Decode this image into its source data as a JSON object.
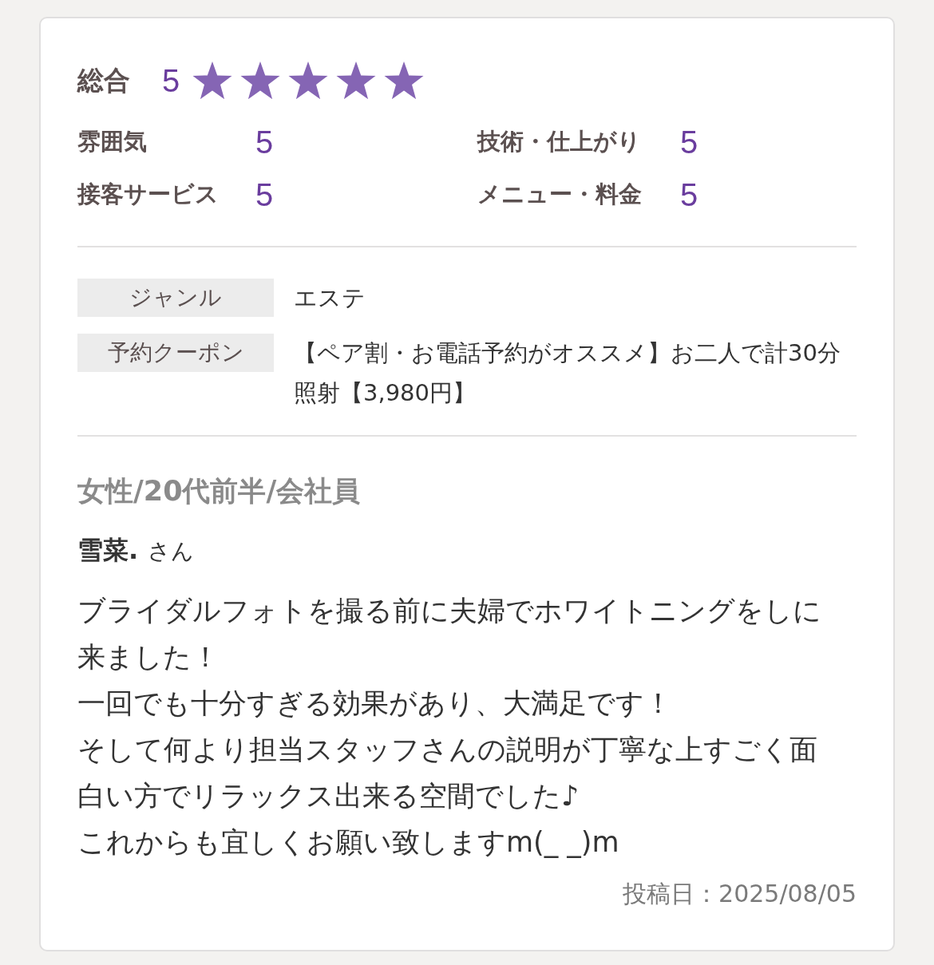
{
  "overall": {
    "label": "総合",
    "score": "5",
    "stars": 5
  },
  "ratings": [
    {
      "label": "雰囲気",
      "score": "5"
    },
    {
      "label": "技術・仕上がり",
      "score": "5"
    },
    {
      "label": "接客サービス",
      "score": "5"
    },
    {
      "label": "メニュー・料金",
      "score": "5"
    }
  ],
  "details": [
    {
      "label": "ジャンル",
      "value": "エステ"
    },
    {
      "label": "予約クーポン",
      "value": "【ペア割・お電話予約がオススメ】お二人で計30分照射【3,980円】"
    }
  ],
  "reviewer": {
    "profile": "女性/20代前半/会社員",
    "name": "雪菜.",
    "honorific": "さん"
  },
  "comment": [
    "ブライダルフォトを撮る前に夫婦でホワイトニングをしに来ました！",
    "一回でも十分すぎる効果があり、大満足です！",
    "そして何より担当スタッフさんの説明が丁寧な上すごく面白い方でリラックス出来る空間でした♪",
    "これからも宜しくお願い致しますm(_ _)m"
  ],
  "posted": "投稿日：2025/08/05"
}
